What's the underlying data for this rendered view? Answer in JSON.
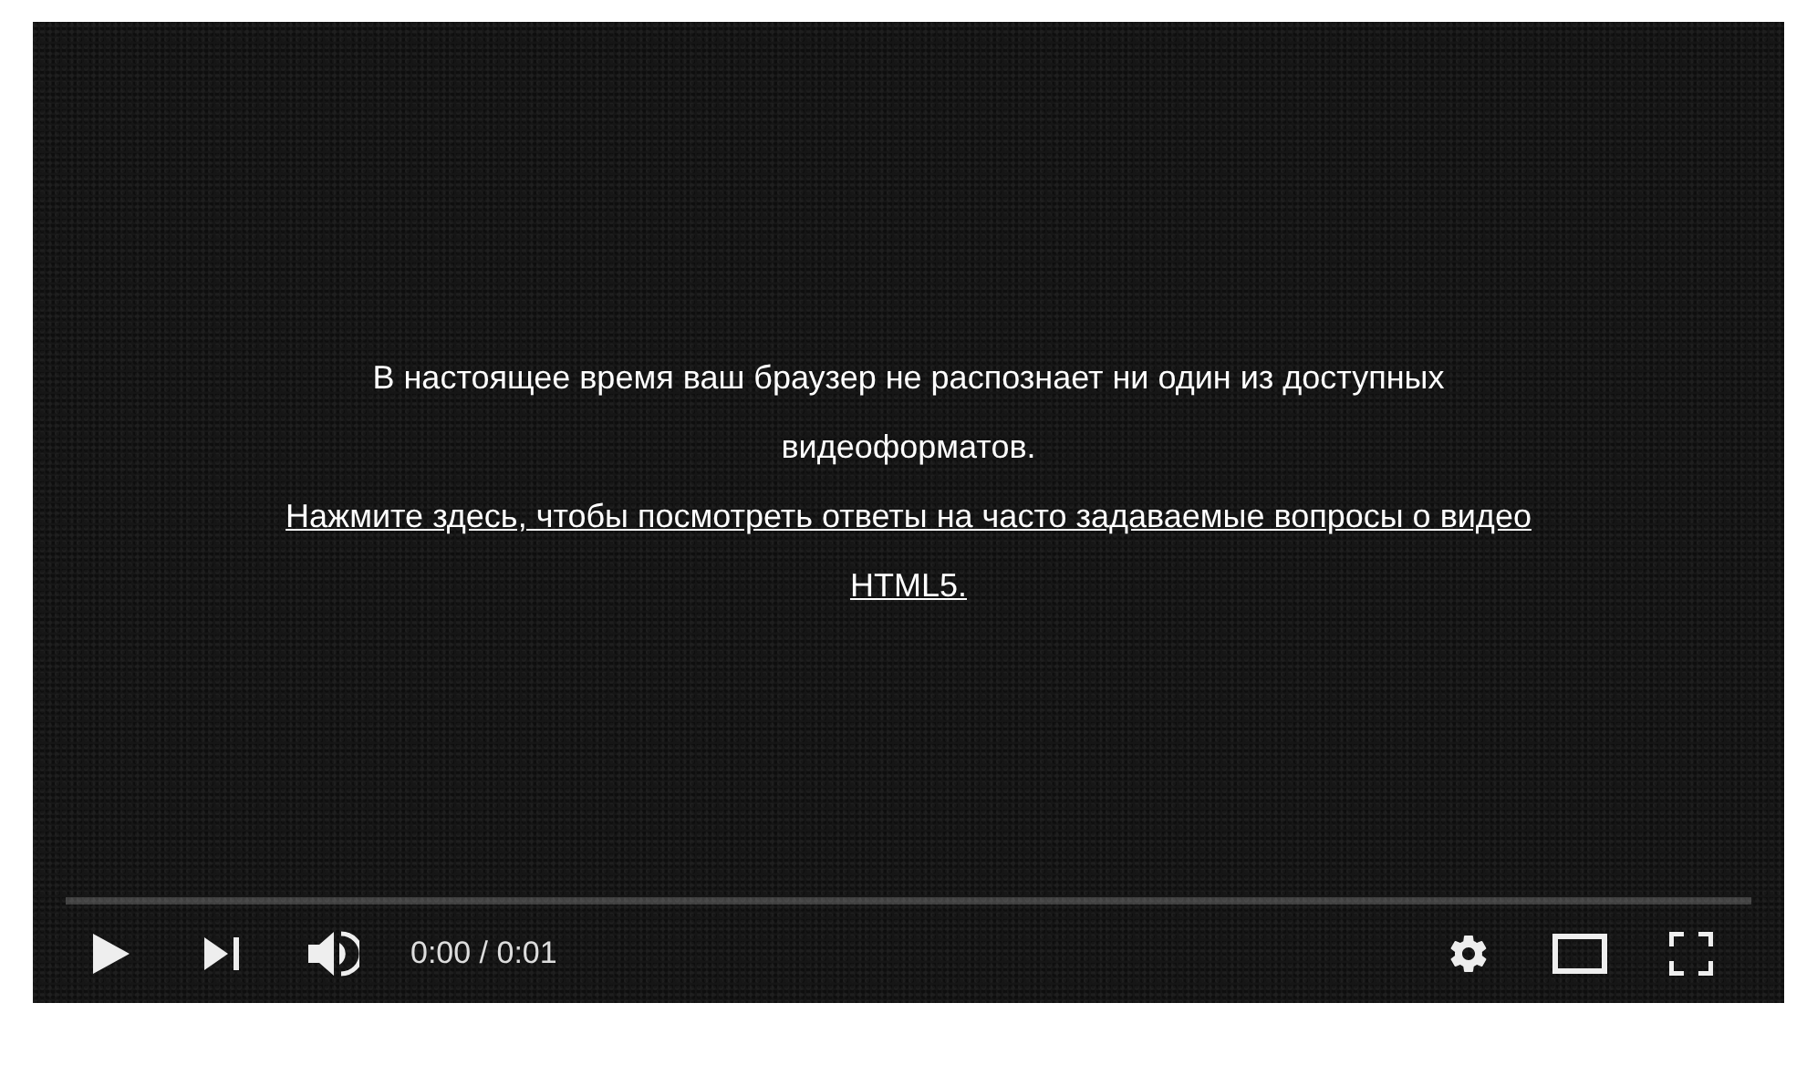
{
  "player": {
    "message": "В настоящее время ваш браузер не распознает ни один из доступных видеоформатов.",
    "help_link": "Нажмите здесь, чтобы посмотреть ответы на часто задаваемые вопросы о видео HTML5.",
    "progress": {
      "level": 0
    },
    "time": "0:00 / 0:01"
  }
}
